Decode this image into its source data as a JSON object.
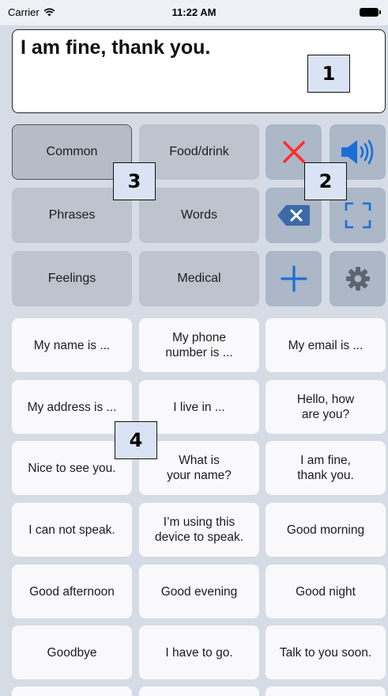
{
  "status": {
    "carrier": "Carrier",
    "time": "11:22 AM"
  },
  "speech": {
    "text": "I am fine, thank you."
  },
  "callouts": [
    "1",
    "2",
    "3",
    "4"
  ],
  "categories": [
    {
      "label": "Common",
      "selected": true
    },
    {
      "label": "Food/drink"
    },
    {
      "label": "Phrases"
    },
    {
      "label": "Words"
    },
    {
      "label": "Feelings"
    },
    {
      "label": "Medical"
    }
  ],
  "tools": [
    {
      "icon": "clear-x-icon"
    },
    {
      "icon": "speaker-icon"
    },
    {
      "icon": "backspace-icon"
    },
    {
      "icon": "fullscreen-icon"
    },
    {
      "icon": "plus-icon"
    },
    {
      "icon": "gear-icon"
    }
  ],
  "colors": {
    "background": "#d5dce5",
    "tool_button": "#acb7c7",
    "category_button": "#bec4cd",
    "accent_blue": "#1a6fd6",
    "clear_red": "#ff2d2d"
  },
  "phrases": [
    "My name is ...",
    "My phone\nnumber is ...",
    "My email is ...",
    "My address is ...",
    "I live in ...",
    "Hello, how\nare you?",
    "Nice to see you.",
    "What is\nyour name?",
    "I am fine,\nthank you.",
    "I can not speak.",
    "I’m using this\ndevice to speak.",
    "Good morning",
    "Good afternoon",
    "Good evening",
    "Good night",
    "Goodbye",
    "I have to go.",
    "Talk to you soon."
  ]
}
